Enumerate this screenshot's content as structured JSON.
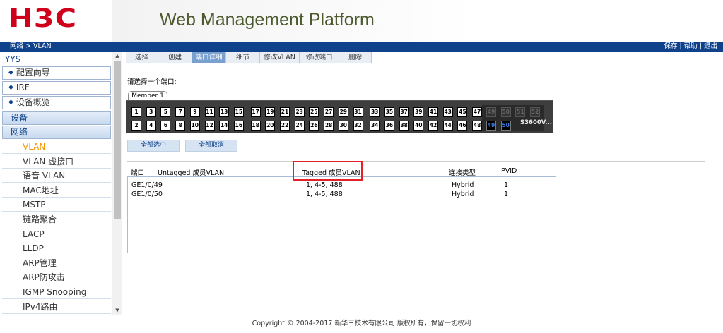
{
  "header": {
    "logo": "H3C",
    "title": "Web Management Platform"
  },
  "topbar": {
    "breadcrumb": "网络 > VLAN",
    "actions": [
      "保存",
      "帮助",
      "退出"
    ],
    "separator": " | "
  },
  "sidebar": {
    "title": "YYS",
    "boxes": [
      {
        "icon": "diamond-icon",
        "label": "配置向导"
      },
      {
        "icon": "diamond-icon",
        "label": "IRF"
      },
      {
        "icon": "diamond-icon",
        "label": "设备概览"
      }
    ],
    "sections": [
      "设备",
      "网络"
    ],
    "items": [
      {
        "label": "VLAN",
        "active": true
      },
      {
        "label": "VLAN 虚接口",
        "active": false
      },
      {
        "label": "语音 VLAN",
        "active": false
      },
      {
        "label": "MAC地址",
        "active": false
      },
      {
        "label": "MSTP",
        "active": false
      },
      {
        "label": "链路聚合",
        "active": false
      },
      {
        "label": "LACP",
        "active": false
      },
      {
        "label": "LLDP",
        "active": false
      },
      {
        "label": "ARP管理",
        "active": false
      },
      {
        "label": "ARP防攻击",
        "active": false
      },
      {
        "label": "IGMP Snooping",
        "active": false
      },
      {
        "label": "IPv4路由",
        "active": false
      }
    ]
  },
  "tabs": [
    {
      "label": "选择",
      "active": false
    },
    {
      "label": "创建",
      "active": false
    },
    {
      "label": "端口详细",
      "active": true
    },
    {
      "label": "细节",
      "active": false
    },
    {
      "label": "修改VLAN",
      "active": false
    },
    {
      "label": "修改端口",
      "active": false
    },
    {
      "label": "删除",
      "active": false
    }
  ],
  "content": {
    "prompt": "请选择一个端口:",
    "member_tab": "Member 1",
    "model": "S3600V...",
    "ports_top": [
      "1",
      "3",
      "5",
      "7",
      "9",
      "11",
      "13",
      "15",
      "17",
      "19",
      "21",
      "23",
      "25",
      "27",
      "29",
      "31",
      "33",
      "35",
      "37",
      "39",
      "41",
      "43",
      "45",
      "47"
    ],
    "ports_bottom": [
      "2",
      "4",
      "6",
      "8",
      "10",
      "12",
      "14",
      "16",
      "18",
      "20",
      "22",
      "24",
      "26",
      "28",
      "30",
      "32",
      "34",
      "36",
      "38",
      "40",
      "42",
      "44",
      "46",
      "48"
    ],
    "sfp_top": [
      "49",
      "50",
      "51",
      "52"
    ],
    "sfp_bottom": [
      "49",
      "50"
    ],
    "select_all": "全部选中",
    "deselect_all": "全部取消"
  },
  "table": {
    "headers": [
      "端口",
      "Untagged 成员VLAN",
      "Tagged 成员VLAN",
      "连接类型",
      "PVID"
    ],
    "rows": [
      {
        "port": "GE1/0/49",
        "untagged": "",
        "tagged": "1, 4-5, 488",
        "type": "Hybrid",
        "pvid": "1"
      },
      {
        "port": "GE1/0/50",
        "untagged": "",
        "tagged": "1, 4-5, 488",
        "type": "Hybrid",
        "pvid": "1"
      }
    ]
  },
  "footer": "Copyright © 2004-2017 新华三技术有限公司 版权所有，保留一切权利",
  "colors": {
    "brand": "#d0021b",
    "nav": "#10428c",
    "active_item": "#f29400",
    "highlight": "#e4202a"
  }
}
